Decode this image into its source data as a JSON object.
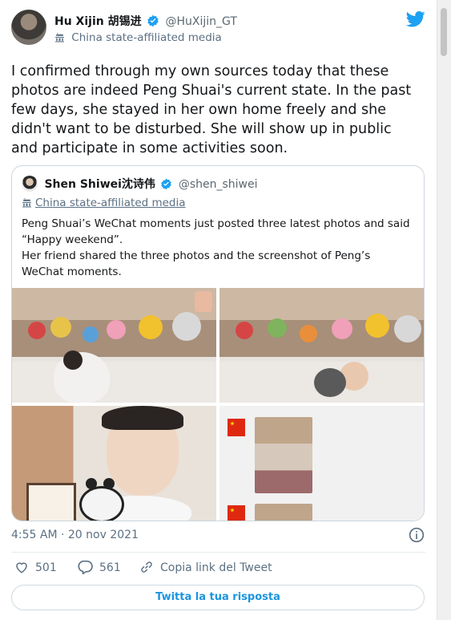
{
  "author": {
    "name": "Hu Xijin 胡锡进",
    "handle": "@HuXijin_GT",
    "affiliation": "China state-affiliated media"
  },
  "tweet": {
    "text": "I confirmed through my own sources today that these photos are indeed Peng Shuai's current state. In the past few days, she stayed in her own home freely and she didn't want to be disturbed. She will show up in public and participate in some activities soon.",
    "timestamp": "4:55 AM · 20 nov 2021"
  },
  "quoted": {
    "name": "Shen Shiwei沈诗伟",
    "handle": "@shen_shiwei",
    "affiliation": "China state-affiliated media",
    "text_line1": "Peng Shuai’s WeChat moments just posted three latest photos and said “Happy weekend”.",
    "text_line2": "Her friend shared the three photos and the screenshot of Peng’s WeChat moments."
  },
  "actions": {
    "likes": "501",
    "replies": "561",
    "copy_link": "Copia link del Tweet",
    "reply_button": "Twitta la tua risposta"
  },
  "colors": {
    "accent": "#1da1f2",
    "verified": "#1da1f2",
    "muted": "#5b7083"
  }
}
